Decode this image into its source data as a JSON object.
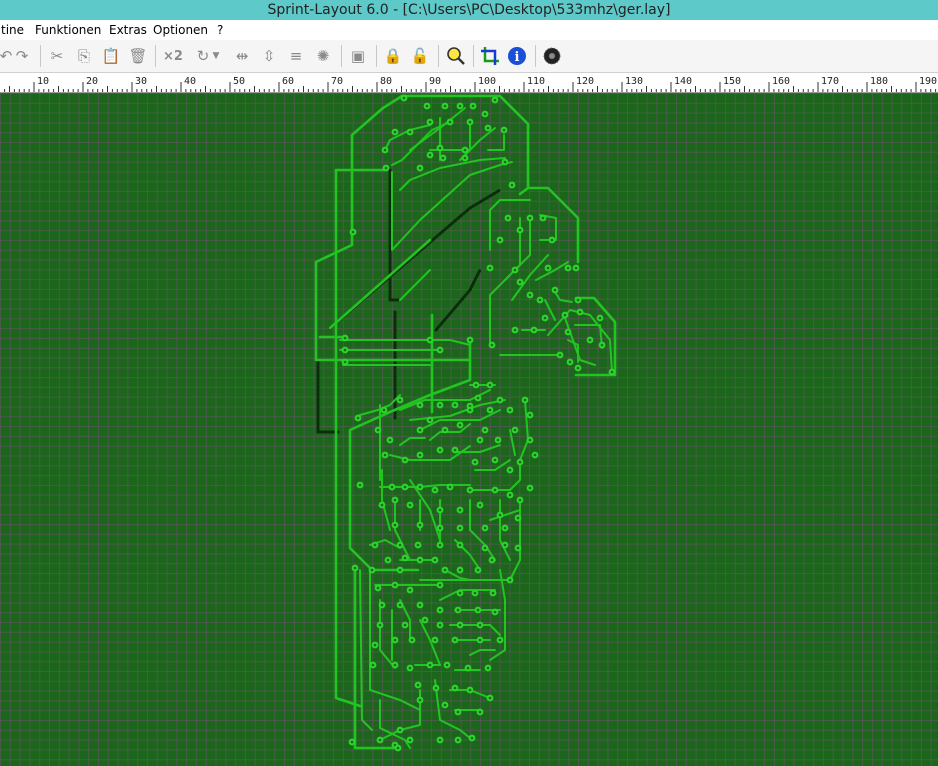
{
  "window": {
    "title": "Sprint-Layout 6.0 - [C:\\Users\\PC\\Desktop\\533mhz\\ger.lay]"
  },
  "menu": {
    "items": [
      "tine",
      "Funktionen",
      "Extras",
      "Optionen",
      "?"
    ]
  },
  "toolbar": {
    "buttons": [
      {
        "name": "undo-icon",
        "glyph": "↶"
      },
      {
        "name": "redo-icon",
        "glyph": "↷"
      },
      {
        "name": "cut-icon",
        "glyph": "✂"
      },
      {
        "name": "copy-icon",
        "glyph": "⎘"
      },
      {
        "name": "paste-icon",
        "glyph": "📋"
      },
      {
        "name": "delete-icon",
        "glyph": "🗑"
      },
      {
        "name": "duplicate-icon",
        "glyph": "×2"
      },
      {
        "name": "rotate-icon",
        "glyph": "↻"
      },
      {
        "name": "mirror-horizontal-icon",
        "glyph": "⇹"
      },
      {
        "name": "mirror-vertical-icon",
        "glyph": "⇳"
      },
      {
        "name": "align-icon",
        "glyph": "≡"
      },
      {
        "name": "highlight-icon",
        "glyph": "✺"
      },
      {
        "name": "group-icon",
        "glyph": "▣"
      },
      {
        "name": "lock-icon",
        "glyph": "🔒"
      },
      {
        "name": "unlock-icon",
        "glyph": "🔓"
      },
      {
        "name": "zoom-icon",
        "glyph": "🔍"
      },
      {
        "name": "crop-icon",
        "glyph": "⌗"
      },
      {
        "name": "info-icon",
        "glyph": "i"
      },
      {
        "name": "pcb-settings-icon",
        "glyph": "◎"
      }
    ],
    "duplicate_label": "×2"
  },
  "ruler": {
    "labels": [
      "10",
      "20",
      "30",
      "40",
      "50",
      "60",
      "70",
      "80",
      "90",
      "100",
      "110",
      "120",
      "130",
      "140",
      "150",
      "160",
      "170",
      "180",
      "190"
    ]
  },
  "colors": {
    "board_bg": "#1c661c",
    "trace": "#22c422",
    "pad": "#2bd62b",
    "pad_hole": "#1c661c",
    "titlebar": "#5ec9c9"
  }
}
